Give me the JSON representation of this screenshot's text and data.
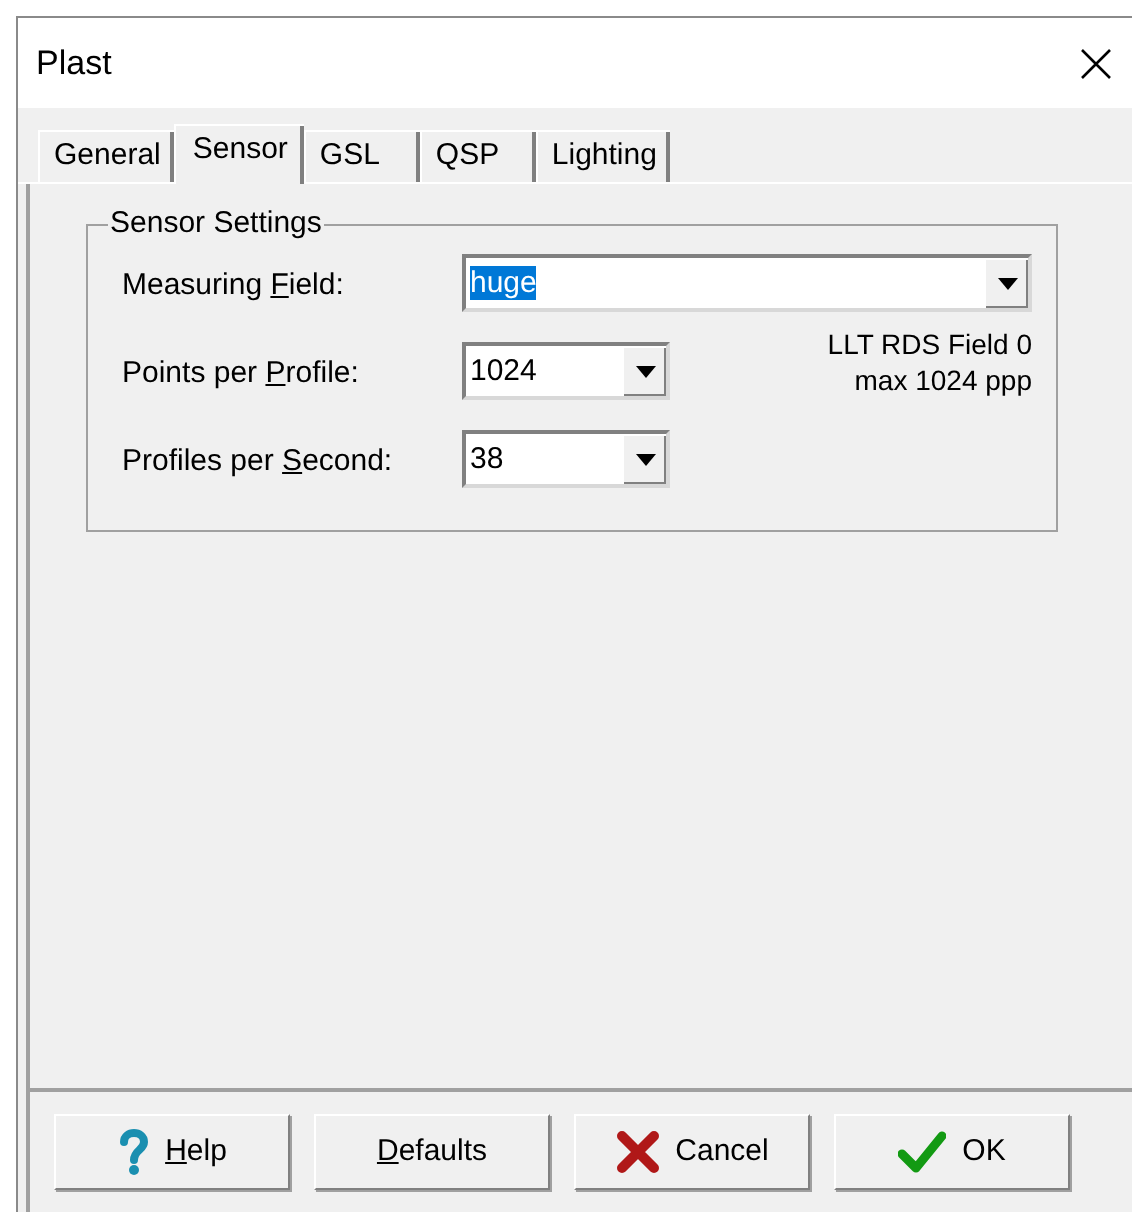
{
  "window": {
    "title": "Plast"
  },
  "tabs": [
    {
      "label": "General",
      "selected": false
    },
    {
      "label": "Sensor",
      "selected": true
    },
    {
      "label": "GSL",
      "selected": false
    },
    {
      "label": "QSP",
      "selected": false
    },
    {
      "label": "Lighting",
      "selected": false
    }
  ],
  "group": {
    "title": "Sensor Settings",
    "fields": [
      {
        "label": {
          "before": "Measuring ",
          "key": "F",
          "after": "ield:"
        },
        "value": "huge",
        "text_selected": true,
        "kind": "wide"
      },
      {
        "label": {
          "before": "Points per ",
          "key": "P",
          "after": "rofile:"
        },
        "value": "1024",
        "text_selected": false,
        "kind": "narrow"
      },
      {
        "label": {
          "before": "Profiles per ",
          "key": "S",
          "after": "econd:"
        },
        "value": "38",
        "text_selected": false,
        "kind": "narrow"
      }
    ],
    "info": [
      "LLT RDS Field 0",
      "max 1024 ppp"
    ]
  },
  "buttons": [
    {
      "kind": "help",
      "label": {
        "key": "H",
        "after": "elp"
      }
    },
    {
      "kind": "defaults",
      "label": {
        "key": "D",
        "after": "efaults"
      }
    },
    {
      "kind": "cancel",
      "label": {
        "after": "Cancel"
      }
    },
    {
      "kind": "ok",
      "label": {
        "after": "OK"
      }
    }
  ]
}
